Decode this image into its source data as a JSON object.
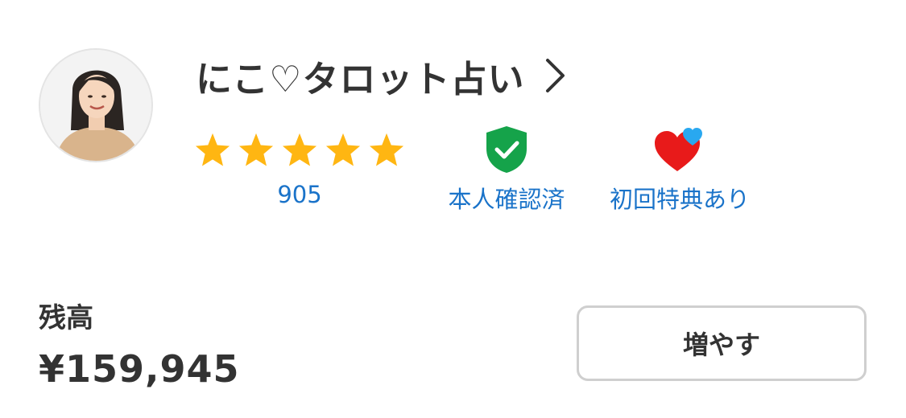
{
  "profile": {
    "name": "にこ♡タロット占い",
    "avatar_icon": "profile-photo",
    "chevron_icon": "chevron-right-icon"
  },
  "rating": {
    "stars": 5,
    "max_stars": 5,
    "star_color": "#FFB612",
    "review_count": "905"
  },
  "verified": {
    "label": "本人確認済",
    "icon_color": "#15A34A"
  },
  "first_time_benefit": {
    "label": "初回特典あり",
    "heart_color": "#E81A1A",
    "small_heart_color": "#29A8F0"
  },
  "balance": {
    "label": "残高",
    "value": "¥159,945"
  },
  "add_button": {
    "label": "増やす"
  },
  "colors": {
    "link_blue": "#1A73C9",
    "text": "#333333",
    "border": "#CFCFCF"
  }
}
